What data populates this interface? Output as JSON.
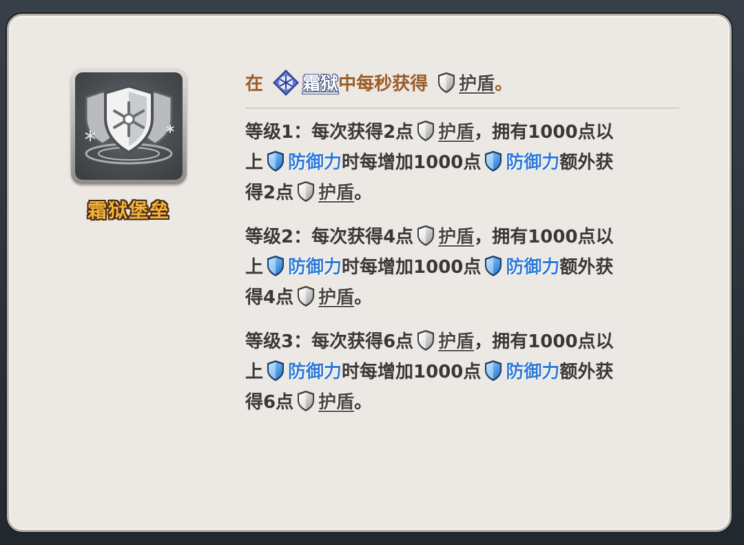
{
  "skill": {
    "name": "霜狱堡垒",
    "icon": "frost-shield-icon"
  },
  "description": {
    "intro": {
      "prefix": "在",
      "frost_keyword": "霜狱",
      "middle": "中每秒获得",
      "shield_keyword": "护盾",
      "suffix": "。"
    },
    "levels": [
      {
        "l1a": "等级1：每次获得2点",
        "shield1": "护盾",
        "l1b": "，拥有1000点以",
        "l2a": "上",
        "def1": "防御力",
        "l2b": "时每增加1000点",
        "def2": "防御力",
        "l2c": "额外获",
        "l3a": "得2点",
        "shield2": "护盾",
        "l3b": "。"
      },
      {
        "l1a": "等级2：每次获得4点",
        "shield1": "护盾",
        "l1b": "，拥有1000点以",
        "l2a": "上",
        "def1": "防御力",
        "l2b": "时每增加1000点",
        "def2": "防御力",
        "l2c": "额外获",
        "l3a": "得4点",
        "shield2": "护盾",
        "l3b": "。"
      },
      {
        "l1a": "等级3：每次获得6点",
        "shield1": "护盾",
        "l1b": "，拥有1000点以",
        "l2a": "上",
        "def1": "防御力",
        "l2b": "时每增加1000点",
        "def2": "防御力",
        "l2c": "额外获",
        "l3a": "得6点",
        "shield2": "护盾",
        "l3b": "。"
      }
    ]
  },
  "colors": {
    "panel_bg": "#ece8e3",
    "skill_name": "#f3b43a",
    "defense_keyword": "#2f79d6",
    "intro_text": "#9a5d28"
  }
}
